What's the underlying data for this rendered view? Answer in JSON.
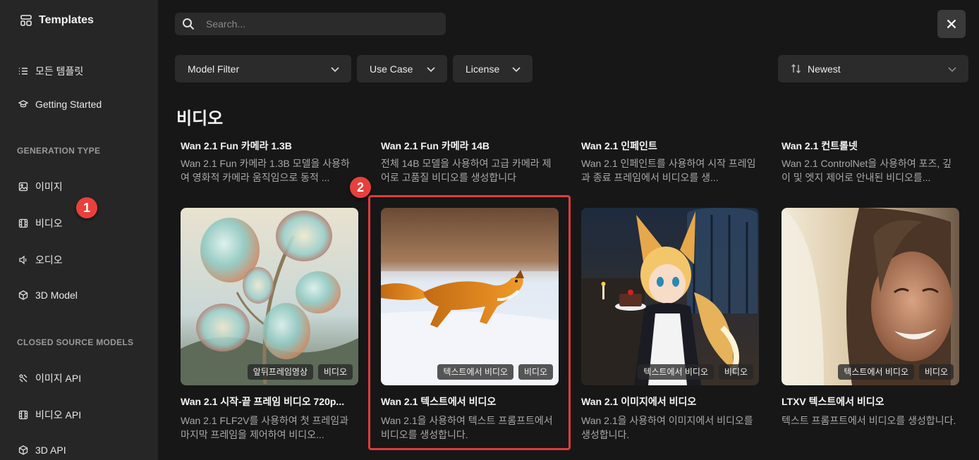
{
  "sidebar": {
    "brand": "Templates",
    "nav": {
      "all_templates": "모든 템플릿",
      "getting_started": "Getting Started"
    },
    "generation_type_label": "GENERATION TYPE",
    "generation_types": [
      "이미지",
      "비디오",
      "오디오",
      "3D Model"
    ],
    "closed_source_label": "CLOSED SOURCE MODELS",
    "closed_source": [
      "이미지 API",
      "비디오 API",
      "3D API"
    ]
  },
  "search": {
    "placeholder": "Search..."
  },
  "filters": {
    "model_filter": "Model Filter",
    "use_case": "Use Case",
    "license": "License",
    "sort": "Newest"
  },
  "section_title": "비디오",
  "cards_top": [
    {
      "title": "Wan 2.1 Fun 카메라 1.3B",
      "desc": "Wan 2.1 Fun 카메라 1.3B 모델을 사용하여 영화적 카메라 움직임으로 동적 ..."
    },
    {
      "title": "Wan 2.1 Fun 카메라 14B",
      "desc": "전체 14B 모델을 사용하여 고급 카메라 제어로 고품질 비디오를 생성합니다"
    },
    {
      "title": "Wan 2.1 인페인트",
      "desc": "Wan 2.1 인페인트를 사용하여 시작 프레임과 종료 프레임에서 비디오를 생..."
    },
    {
      "title": "Wan 2.1 컨트롤넷",
      "desc": "Wan 2.1 ControlNet을 사용하여 포즈, 깊이 및 엣지 제어로 안내된 비디오를..."
    }
  ],
  "cards_bottom": [
    {
      "title": "Wan 2.1 시작-끝 프레임 비디오 720p...",
      "desc": "Wan 2.1 FLF2V를 사용하여 첫 프레임과 마지막 프레임을 제어하여 비디오...",
      "badges": [
        "앞뒤프레임영상",
        "비디오"
      ]
    },
    {
      "title": "Wan 2.1 텍스트에서 비디오",
      "desc": "Wan 2.1을 사용하여 텍스트 프롬프트에서 비디오를 생성합니다.",
      "badges": [
        "텍스트에서 비디오",
        "비디오"
      ]
    },
    {
      "title": "Wan 2.1 이미지에서 비디오",
      "desc": "Wan 2.1을 사용하여 이미지에서 비디오를 생성합니다.",
      "badges": [
        "텍스트에서 비디오",
        "비디오"
      ]
    },
    {
      "title": "LTXV 텍스트에서 비디오",
      "desc": "텍스트 프롬프트에서 비디오를 생성합니다.",
      "badges": [
        "텍스트에서 비디오",
        "비디오"
      ]
    }
  ],
  "annotations": {
    "step1": "1",
    "step2": "2"
  },
  "colors": {
    "highlight": "#e03c3c",
    "step_badge": "#e8403c"
  },
  "icons": {
    "brand": "templates-icon",
    "all_templates": "list-icon",
    "getting_started": "graduation-cap-icon",
    "image": "image-icon",
    "video": "film-icon",
    "audio": "speaker-icon",
    "model3d": "cube-icon",
    "search": "search-icon",
    "close": "close-icon",
    "sort": "sort-arrows-icon"
  }
}
